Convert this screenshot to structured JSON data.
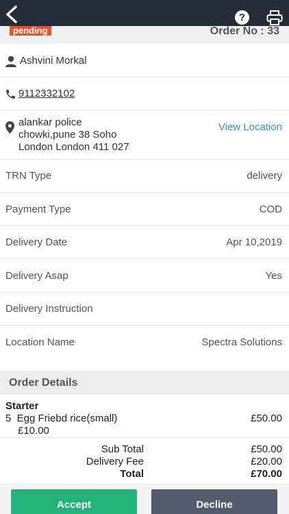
{
  "header": {
    "help_glyph": "?"
  },
  "order": {
    "status": "pending",
    "order_no_label": "Order No : 33"
  },
  "customer": {
    "name": "Ashvini Morkal",
    "phone": "9112332102",
    "address_lines": [
      "alankar police",
      "chowki,pune 38 Soho",
      "London London 411 027"
    ],
    "view_location_label": "View Location"
  },
  "info_rows": [
    {
      "label": "TRN Type",
      "value": "delivery"
    },
    {
      "label": "Payment Type",
      "value": "COD"
    },
    {
      "label": "Delivery Date",
      "value": "Apr 10,2019"
    },
    {
      "label": "Delivery Asap",
      "value": "Yes"
    },
    {
      "label": "Delivery Instruction",
      "value": ""
    },
    {
      "label": "Location Name",
      "value": "Spectra Solutions"
    }
  ],
  "order_details": {
    "title": "Order Details",
    "category": "Starter",
    "item": {
      "line": "5  Egg Friebd rice(small)",
      "price": "£50.00",
      "unit_price": "£10.00"
    }
  },
  "totals": [
    {
      "label": "Sub Total",
      "value": "£50.00"
    },
    {
      "label": "Delivery Fee",
      "value": "£20.00"
    },
    {
      "label": "Total",
      "value": "£70.00"
    }
  ],
  "actions": {
    "accept": "Accept",
    "decline": "Decline"
  },
  "colors": {
    "topbar": "#262d39",
    "status_badge": "#e8532f",
    "link": "#3a8fc7",
    "accept": "#22b37b",
    "decline": "#545b6c"
  },
  "icons": [
    "back-chevron-icon",
    "help-icon",
    "printer-icon",
    "person-icon",
    "phone-icon",
    "location-pin-icon"
  ]
}
